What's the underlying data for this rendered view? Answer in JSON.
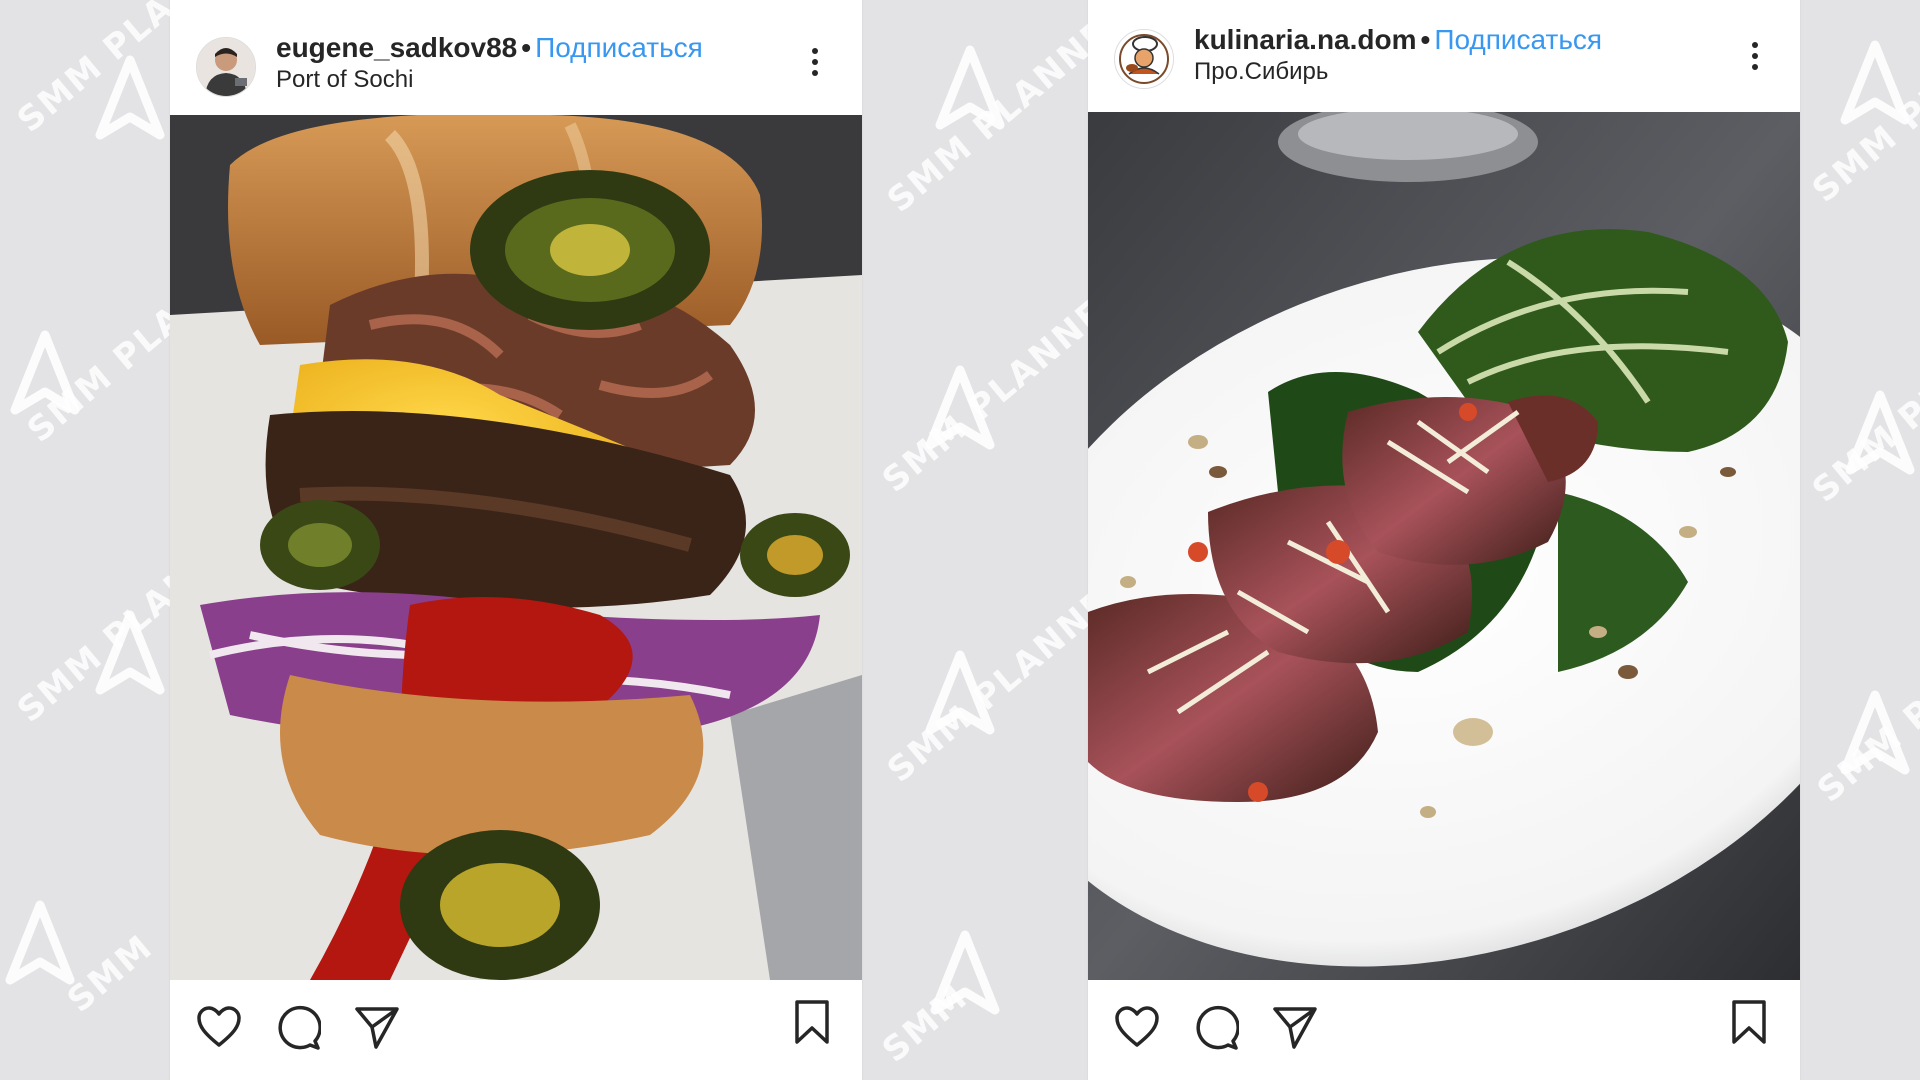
{
  "watermark": {
    "text_smm": "SMM",
    "text_planner": "PLANNER"
  },
  "posts": [
    {
      "username": "eugene_sadkov88",
      "separator": "•",
      "follow_label": "Подписаться",
      "location": "Port of Sochi",
      "photo_subject": "burger-photo",
      "actions": [
        "heart-icon",
        "comment-icon",
        "share-icon",
        "bookmark-icon"
      ]
    },
    {
      "username": "kulinaria.na.dom",
      "separator": "•",
      "follow_label": "Подписаться",
      "location": "Про.Сибирь",
      "photo_subject": "steak-photo",
      "actions": [
        "heart-icon",
        "comment-icon",
        "share-icon",
        "bookmark-icon"
      ]
    }
  ],
  "colors": {
    "background": "#e3e3e6",
    "follow_link": "#3897f0",
    "text": "#262626"
  }
}
